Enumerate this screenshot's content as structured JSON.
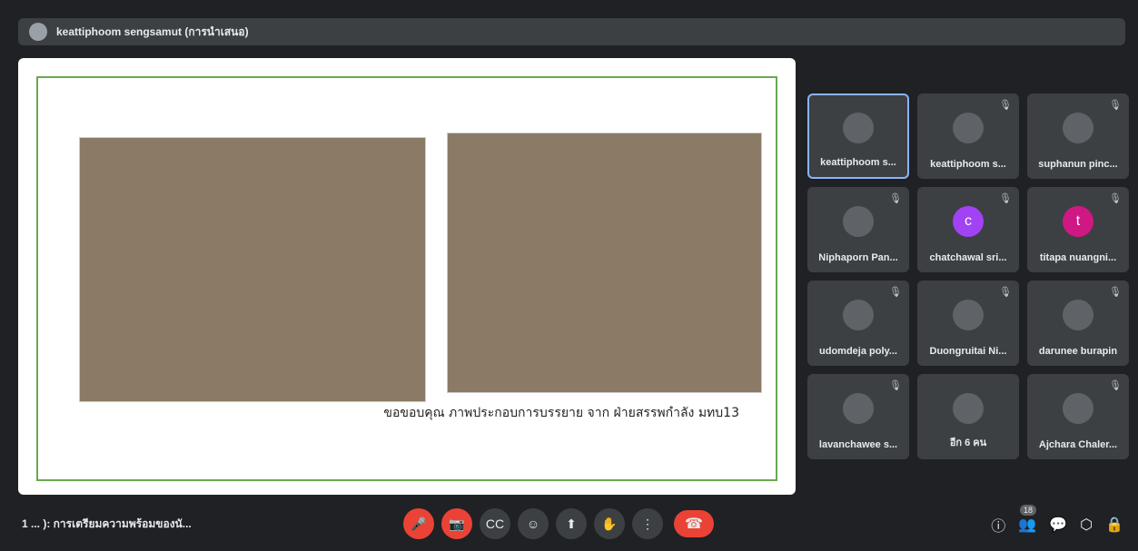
{
  "topbar": {
    "presenter_title": "keattiphoom sengsamut (การนำเสนอ)"
  },
  "slide": {
    "caption": "ขอขอบคุณ ภาพประกอบการบรรยาย จาก ฝ่ายสรรพกำลัง มทบ13"
  },
  "participants": [
    {
      "name": "keattiphoom s...",
      "initial": "",
      "muted": false
    },
    {
      "name": "keattiphoom s...",
      "initial": "",
      "muted": true
    },
    {
      "name": "suphanun pinc...",
      "initial": "",
      "muted": true
    },
    {
      "name": "Niphaporn Pan...",
      "initial": "",
      "muted": true
    },
    {
      "name": "chatchawal sri...",
      "initial": "c",
      "muted": true,
      "color": "#a142f4"
    },
    {
      "name": "titapa nuangni...",
      "initial": "t",
      "muted": true,
      "color": "#d01884"
    },
    {
      "name": "udomdeja poly...",
      "initial": "",
      "muted": true
    },
    {
      "name": "Duongruitai Ni...",
      "initial": "",
      "muted": true
    },
    {
      "name": "darunee burapin",
      "initial": "",
      "muted": true
    },
    {
      "name": "lavanchawee s...",
      "initial": "",
      "muted": true
    },
    {
      "name": "อีก 6 คน",
      "initial": "",
      "muted": false
    },
    {
      "name": "Ajchara Chaler...",
      "initial": "",
      "muted": true
    }
  ],
  "bottombar": {
    "meeting_title": "1 ... ): การเตรียมความพร้อมของนั...",
    "people_count": "18"
  }
}
